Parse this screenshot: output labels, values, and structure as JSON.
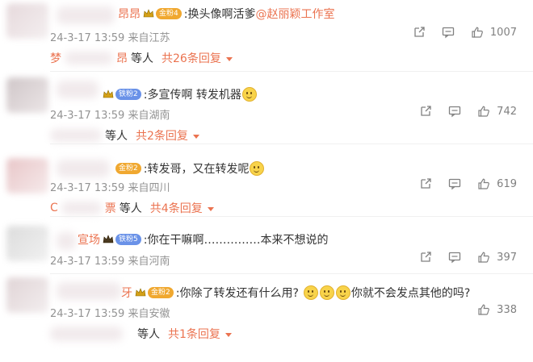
{
  "comments": [
    {
      "name": "昂昂",
      "badge": "金粉4",
      "badge_color": "gold",
      "text": ":换头像啊活爹",
      "mention": "@赵丽颖工作室",
      "emoji_after": 0,
      "text2": "",
      "emoji_after2": 0,
      "meta": "24-3-17 13:59 来自江苏",
      "likes": "1007",
      "reply_name": "梦",
      "reply_name2": "昂",
      "reply_deng": "等人",
      "reply_total": "共26条回复"
    },
    {
      "name": "",
      "badge": "铁粉2",
      "badge_color": "blue",
      "text": ":多宣传啊 转发机器",
      "mention": "",
      "emoji_after": 1,
      "text2": "",
      "emoji_after2": 0,
      "meta": "24-3-17 13:59 来自湖南",
      "likes": "742",
      "reply_name": "",
      "reply_name2": "",
      "reply_deng": "等人",
      "reply_total": "共2条回复"
    },
    {
      "name": "",
      "badge": "金粉2",
      "badge_color": "gold",
      "text": ":转发哥，又在转发呢",
      "mention": "",
      "emoji_after": 1,
      "text2": "",
      "emoji_after2": 0,
      "meta": "24-3-17 13:59 来自四川",
      "likes": "619",
      "reply_name": "C",
      "reply_name2": "票",
      "reply_deng": "等人",
      "reply_total": "共4条回复"
    },
    {
      "name": "宣场",
      "badge": "铁粉5",
      "badge_color": "blue",
      "text": ":你在干嘛啊……………本来不想说的",
      "mention": "",
      "emoji_after": 0,
      "text2": "",
      "emoji_after2": 0,
      "meta": "24-3-17 13:59 来自河南",
      "likes": "397",
      "reply_name": "",
      "reply_name2": "",
      "reply_deng": "",
      "reply_total": ""
    },
    {
      "name": "牙",
      "badge": "金粉2",
      "badge_color": "gold",
      "text": ":你除了转发还有什么用?",
      "mention": "",
      "emoji_after": 3,
      "text2": "你就不会发点其他的吗?",
      "emoji_after2": 0,
      "meta": "24-3-17 13:59 来自安徽",
      "likes": "338",
      "reply_name": "",
      "reply_name2": "",
      "reply_deng": "等人",
      "reply_total": "共1条回复"
    }
  ],
  "icons": {
    "share": "share-icon",
    "comment": "comment-icon",
    "like": "thumbs-up-icon",
    "crown": "crown-icon",
    "caret": "caret-down-icon"
  },
  "colors": {
    "accent": "#eb7350",
    "meta": "#939393",
    "gold_badge": "#f0a830",
    "blue_badge": "#6a92e8"
  }
}
